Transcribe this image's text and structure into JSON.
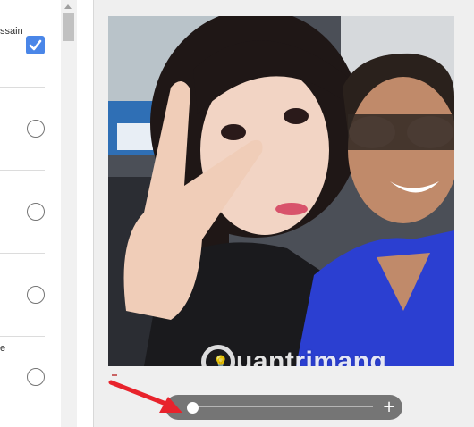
{
  "options_panel": {
    "first_option_label": "ssain",
    "fifth_option_label": "e",
    "first_option_checked": true
  },
  "preview": {
    "watermark_brand": "uantrimang",
    "watermark_icon": "lightbulb-q-logo"
  },
  "zoom": {
    "plus_label": "+",
    "level": 0.0
  },
  "colors": {
    "checkbox_blue": "#4a86e8",
    "slider_bg": "#757575",
    "annotation_arrow": "#e8232c"
  },
  "icons": {
    "check": "checkmark-icon",
    "scroll_up": "scroll-up-arrow-icon",
    "plus": "plus-icon",
    "arrow": "red-annotation-arrow"
  }
}
